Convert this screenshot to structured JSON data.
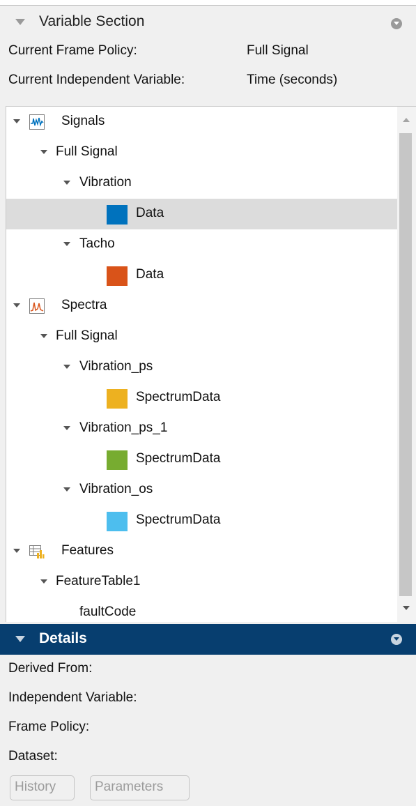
{
  "variable_section": {
    "title": "Variable Section",
    "frame_policy_label": "Current Frame Policy:",
    "frame_policy_value": "Full Signal",
    "indep_var_label": "Current Independent Variable:",
    "indep_var_value": "Time (seconds)"
  },
  "tree": {
    "signals": {
      "label": "Signals",
      "full_signal": "Full Signal",
      "vibration": "Vibration",
      "vibration_data": "Data",
      "tacho": "Tacho",
      "tacho_data": "Data"
    },
    "spectra": {
      "label": "Spectra",
      "full_signal": "Full Signal",
      "vibration_ps": "Vibration_ps",
      "vibration_ps_data": "SpectrumData",
      "vibration_ps_1": "Vibration_ps_1",
      "vibration_ps_1_data": "SpectrumData",
      "vibration_os": "Vibration_os",
      "vibration_os_data": "SpectrumData"
    },
    "features": {
      "label": "Features",
      "feature_table": "FeatureTable1",
      "fault_code": "faultCode"
    },
    "selected_item": "Data",
    "colors": {
      "vibration_data": "#0072bd",
      "tacho_data": "#d95319",
      "vibration_ps": "#edb120",
      "vibration_ps_1": "#77ac30",
      "vibration_os": "#4dbeee"
    }
  },
  "details": {
    "title": "Details",
    "derived_from": "Derived From:",
    "independent_variable": "Independent Variable:",
    "frame_policy": "Frame Policy:",
    "dataset": "Dataset:",
    "history_button": "History",
    "parameters_button": "Parameters"
  }
}
